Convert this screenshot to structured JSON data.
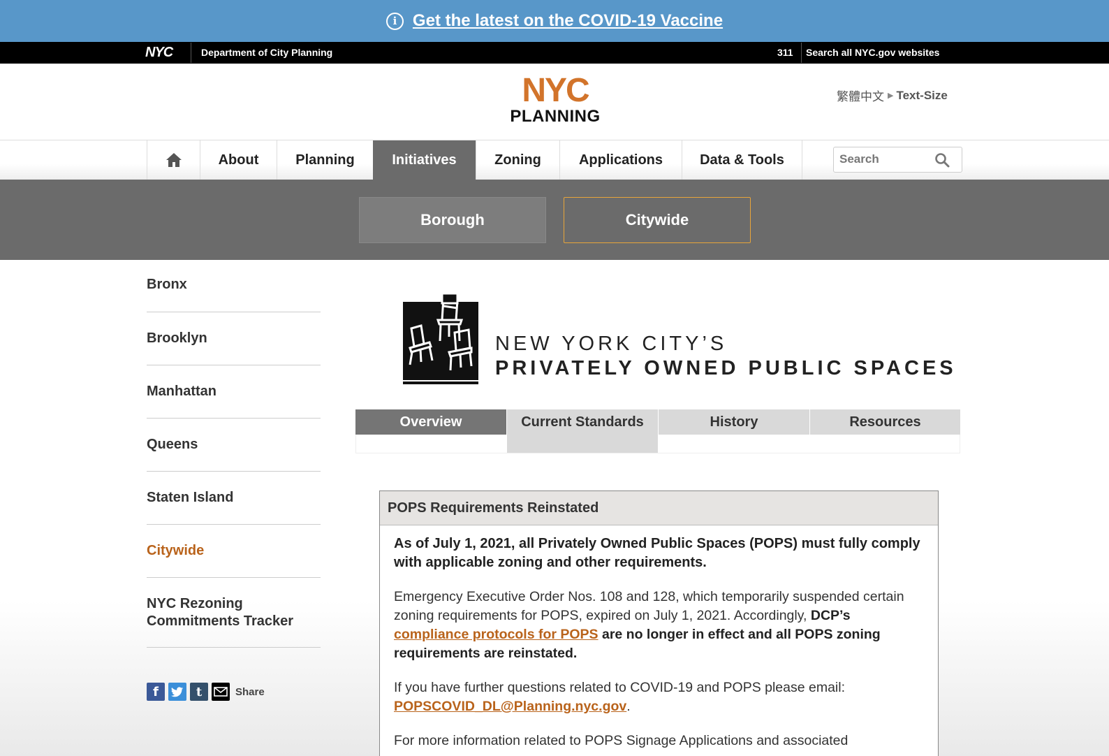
{
  "covid_banner": {
    "text": "Get the latest on the COVID-19 Vaccine"
  },
  "nyc_bar": {
    "logo": "NYC",
    "department": "Department of City Planning",
    "link_311": "311",
    "search_all": "Search all NYC.gov websites"
  },
  "header": {
    "logo_top": "NYC",
    "logo_bottom": "PLANNING",
    "language": "繁體中文",
    "text_size": "Text-Size"
  },
  "main_nav": {
    "items": [
      {
        "label": "About"
      },
      {
        "label": "Planning"
      },
      {
        "label": "Initiatives",
        "active": true
      },
      {
        "label": "Zoning"
      },
      {
        "label": "Applications"
      },
      {
        "label": "Data & Tools"
      }
    ],
    "search_placeholder": "Search"
  },
  "sub_nav": {
    "borough": "Borough",
    "citywide": "Citywide"
  },
  "sidebar": {
    "items": [
      {
        "label": "Bronx"
      },
      {
        "label": "Brooklyn"
      },
      {
        "label": "Manhattan"
      },
      {
        "label": "Queens"
      },
      {
        "label": "Staten Island"
      },
      {
        "label": "Citywide",
        "active": true
      },
      {
        "label": "NYC Rezoning Commitments Tracker"
      }
    ],
    "share_label": "Share"
  },
  "pops": {
    "title_line1": "NEW YORK CITY’S",
    "title_line2": "PRIVATELY OWNED PUBLIC SPACES"
  },
  "tabs": [
    {
      "label": "Overview",
      "active": true
    },
    {
      "label": "Current Standards"
    },
    {
      "label": "History"
    },
    {
      "label": "Resources"
    }
  ],
  "notice": {
    "heading": "POPS Requirements Reinstated",
    "lead": "As of July 1, 2021, all Privately Owned Public Spaces (POPS) must fully comply with applicable zoning and other requirements.",
    "p2_start": "Emergency Executive Order Nos. 108 and 128, which temporarily suspended certain zoning requirements for POPS, expired on July 1, 2021. Accordingly, ",
    "p2_bold1": "DCP’s",
    "p2_link": "compliance protocols for POPS",
    "p2_bold2": " are no longer in effect and all POPS zoning requirements are reinstated.",
    "p3_text": "If you have further questions related to COVID-19 and POPS please email:",
    "p3_email": "POPSCOVID_DL@Planning.nyc.gov",
    "p3_end": ".",
    "p4_text": "For more information related to POPS Signage Applications and associated"
  },
  "colors": {
    "banner_blue": "#5897c9",
    "logo_orange": "#d2742b",
    "link_orange": "#b9631b",
    "nav_active_gray": "#6b6b6b",
    "citywide_border": "#e8a53a"
  }
}
